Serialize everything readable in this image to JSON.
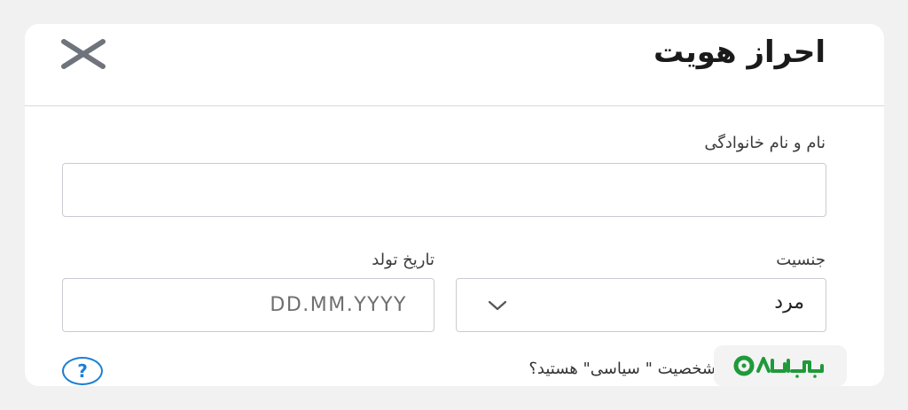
{
  "dialog": {
    "title": "احراز هویت",
    "close_icon": "close-icon"
  },
  "form": {
    "full_name": {
      "label": "نام و نام خانوادگی",
      "value": "",
      "placeholder": ""
    },
    "birth_date": {
      "label": "تاریخ تولد",
      "value": "",
      "placeholder": "DD.MM.YYYY"
    },
    "gender": {
      "label": "جنسیت",
      "selected": "مرد",
      "icon": "chevron-down-icon"
    },
    "pep_question": "شخصیت \" سیاسی\" هستید؟",
    "help_icon": "help-icon"
  },
  "watermark": {
    "logo": "soodup-logo",
    "text": "SOODUP"
  },
  "colors": {
    "accent": "#1b7fd4",
    "border": "#c9cbd1",
    "logo_green": "#1f9a3a"
  }
}
